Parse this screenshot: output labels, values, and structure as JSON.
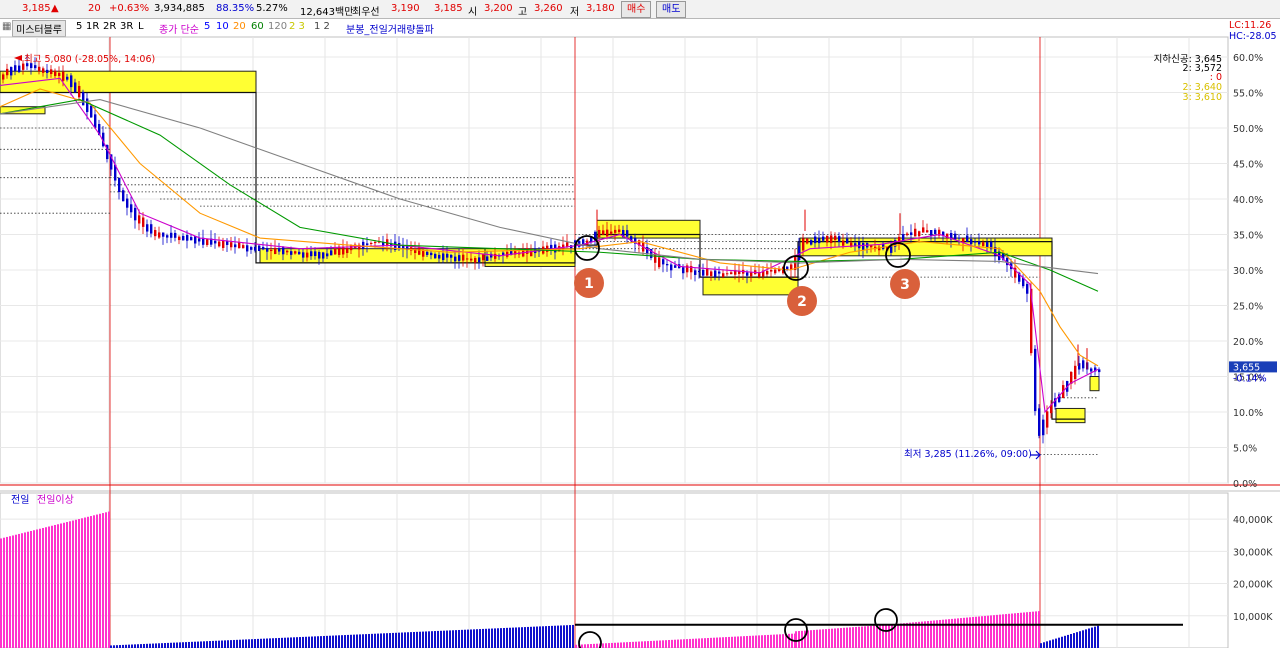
{
  "quote": {
    "price": "3,185",
    "change": "20",
    "change_pct": "+0.63%",
    "volume": "3,934,885",
    "vol_ratio": "88.35%",
    "turnover": "5.27%",
    "amount": "12,643백만",
    "best_label": "최우선",
    "best_ask": "3,190",
    "best_bid": "3,185",
    "open_label": "시",
    "open": "3,200",
    "high_label": "고",
    "high": "3,260",
    "low_label": "저",
    "low": "3,180",
    "buy_label": "매수",
    "sell_label": "매도"
  },
  "toolbar": {
    "chart_name": "미스터블루",
    "periods": [
      "5",
      "1R",
      "2R",
      "3R",
      "L"
    ],
    "ma_label": "종가 단순",
    "ma_periods": [
      {
        "label": "5",
        "color": "#0000ff"
      },
      {
        "label": "10",
        "color": "#0000ff"
      },
      {
        "label": "20",
        "color": "#ff8c00"
      },
      {
        "label": "60",
        "color": "#008000"
      },
      {
        "label": "120",
        "color": "#808080"
      },
      {
        "label": "2 3",
        "color": "#dddd00"
      }
    ],
    "extra": "1 2",
    "indicator": "분봉_전일거래량돌파"
  },
  "icons": {
    "grid": "grid-icon",
    "arrow": "up-triangle-icon"
  },
  "colors": {
    "up": "#e00000",
    "down": "#0000cc",
    "ma5": "#cc00cc",
    "ma10": "#0000ff",
    "ma20": "#ff9900",
    "ma60": "#009900",
    "ma120": "#808080",
    "box": "#ffff33",
    "volume_prev": "#ff33cc",
    "volume_cur": "#1111cc",
    "marker": "#d9603b"
  },
  "chart_data": {
    "type": "candlestick-percent-chart",
    "price_axis": {
      "ticks": [
        "60.0%",
        "55.0%",
        "50.0%",
        "45.0%",
        "40.0%",
        "35.0%",
        "30.0%",
        "25.0%",
        "20.0%",
        "15.0%",
        "10.0%",
        "5.0%",
        "0.0%"
      ],
      "range": [
        0,
        60
      ],
      "lc": "LC:11.26",
      "hc": "HC:-28.05"
    },
    "volume_axis": {
      "ticks": [
        "40,000K",
        "30,000K",
        "20,000K",
        "10,000K"
      ],
      "range": [
        0,
        45000
      ]
    },
    "info_box": {
      "line1": "지하신공: 3,645",
      "line2": "2: 3,572",
      "line3": ": 0",
      "line4": "2: 3,640",
      "line5": "3: 3,610"
    },
    "high_annotation": "최고 5,080 (-28.05%, 14:06)",
    "low_annotation": "최저 3,285 (11.26%, 09:00)",
    "current_label": "3,655",
    "current_change": "-0.14%",
    "current_pct": 16,
    "volume_legend": {
      "series1": "전일",
      "series2": "전일이상"
    },
    "markers": [
      "1",
      "2",
      "3"
    ],
    "price_path": [
      [
        0,
        57
      ],
      [
        25,
        59
      ],
      [
        50,
        58
      ],
      [
        70,
        57
      ],
      [
        85,
        54
      ],
      [
        100,
        50
      ],
      [
        110,
        46
      ],
      [
        125,
        40
      ],
      [
        140,
        37
      ],
      [
        160,
        35
      ],
      [
        185,
        34.5
      ],
      [
        210,
        34
      ],
      [
        235,
        33.5
      ],
      [
        260,
        33
      ],
      [
        290,
        32.5
      ],
      [
        320,
        32
      ],
      [
        350,
        33
      ],
      [
        380,
        34
      ],
      [
        410,
        33
      ],
      [
        440,
        32
      ],
      [
        470,
        31.5
      ],
      [
        500,
        32
      ],
      [
        530,
        32.5
      ],
      [
        575,
        33.5
      ],
      [
        590,
        34
      ],
      [
        600,
        35
      ],
      [
        620,
        35.5
      ],
      [
        640,
        34
      ],
      [
        660,
        31
      ],
      [
        690,
        30
      ],
      [
        720,
        29.5
      ],
      [
        760,
        29.5
      ],
      [
        795,
        30.5
      ],
      [
        805,
        34
      ],
      [
        830,
        34.5
      ],
      [
        860,
        33.5
      ],
      [
        890,
        33
      ],
      [
        905,
        35
      ],
      [
        930,
        35.5
      ],
      [
        960,
        34.5
      ],
      [
        990,
        33.5
      ],
      [
        1010,
        31
      ],
      [
        1030,
        27
      ],
      [
        1040,
        6
      ],
      [
        1050,
        10
      ],
      [
        1060,
        12
      ],
      [
        1070,
        14
      ],
      [
        1080,
        17
      ],
      [
        1090,
        16
      ],
      [
        1098,
        16
      ]
    ],
    "ma_paths": {
      "ma5": [
        [
          0,
          56
        ],
        [
          60,
          57
        ],
        [
          100,
          49
        ],
        [
          140,
          38
        ],
        [
          200,
          34.5
        ],
        [
          300,
          33
        ],
        [
          400,
          33.5
        ],
        [
          500,
          32
        ],
        [
          580,
          33.5
        ],
        [
          620,
          35
        ],
        [
          680,
          30.5
        ],
        [
          760,
          29.6
        ],
        [
          810,
          33
        ],
        [
          880,
          33.6
        ],
        [
          940,
          35
        ],
        [
          1000,
          32
        ],
        [
          1030,
          28
        ],
        [
          1045,
          10
        ],
        [
          1070,
          14
        ],
        [
          1098,
          16
        ]
      ],
      "ma20": [
        [
          0,
          53
        ],
        [
          40,
          55.5
        ],
        [
          90,
          53.5
        ],
        [
          140,
          45
        ],
        [
          200,
          38
        ],
        [
          260,
          34.5
        ],
        [
          350,
          33.5
        ],
        [
          450,
          32.5
        ],
        [
          580,
          33
        ],
        [
          640,
          34
        ],
        [
          720,
          31
        ],
        [
          790,
          30
        ],
        [
          850,
          32.5
        ],
        [
          920,
          34
        ],
        [
          1000,
          33
        ],
        [
          1040,
          27
        ],
        [
          1060,
          22
        ],
        [
          1080,
          18
        ],
        [
          1098,
          16.5
        ]
      ],
      "ma60": [
        [
          0,
          52
        ],
        [
          80,
          54
        ],
        [
          160,
          49
        ],
        [
          230,
          42
        ],
        [
          300,
          36
        ],
        [
          400,
          33.5
        ],
        [
          500,
          33
        ],
        [
          600,
          32.5
        ],
        [
          700,
          31.5
        ],
        [
          800,
          31.2
        ],
        [
          900,
          31.5
        ],
        [
          1000,
          32.5
        ],
        [
          1050,
          30
        ],
        [
          1098,
          27
        ]
      ],
      "ma120": [
        [
          0,
          52
        ],
        [
          100,
          54
        ],
        [
          200,
          50
        ],
        [
          300,
          45
        ],
        [
          400,
          40
        ],
        [
          500,
          36
        ],
        [
          600,
          33
        ],
        [
          700,
          31.5
        ],
        [
          800,
          31
        ],
        [
          900,
          31.5
        ],
        [
          1000,
          31.2
        ],
        [
          1098,
          29.5
        ]
      ]
    },
    "boxes": [
      {
        "x0": 0,
        "x1": 256,
        "top": 58,
        "bottom": 55
      },
      {
        "x0": 0,
        "x1": 45,
        "top": 53,
        "bottom": 52
      },
      {
        "x0": 260,
        "x1": 485,
        "top": 33,
        "bottom": 31
      },
      {
        "x0": 485,
        "x1": 575,
        "top": 33,
        "bottom": 30.5
      },
      {
        "x0": 597,
        "x1": 700,
        "top": 37,
        "bottom": 34.5
      },
      {
        "x0": 703,
        "x1": 798,
        "top": 29,
        "bottom": 26.5
      },
      {
        "x0": 800,
        "x1": 1052,
        "top": 34.5,
        "bottom": 32
      },
      {
        "x0": 1056,
        "x1": 1085,
        "top": 10.5,
        "bottom": 8.5
      },
      {
        "x0": 1090,
        "x1": 1099,
        "top": 15,
        "bottom": 13
      }
    ],
    "volume": {
      "segments": [
        {
          "x0": 0,
          "x1": 110,
          "v0": 34000,
          "v1": 42500,
          "series": "prev"
        },
        {
          "x0": 110,
          "x1": 575,
          "v0": 800,
          "v1": 7200,
          "series": "cur"
        },
        {
          "x0": 575,
          "x1": 795,
          "v0": 1000,
          "v1": 4500,
          "series": "prev"
        },
        {
          "x0": 795,
          "x1": 885,
          "v0": 5200,
          "v1": 7200,
          "series": "prev"
        },
        {
          "x0": 885,
          "x1": 1040,
          "v0": 7200,
          "v1": 11500,
          "series": "prev"
        },
        {
          "x0": 1040,
          "x1": 1100,
          "v0": 1500,
          "v1": 7200,
          "series": "cur"
        }
      ],
      "threshold": 7200
    },
    "day_separators": [
      110,
      575,
      1040
    ]
  }
}
